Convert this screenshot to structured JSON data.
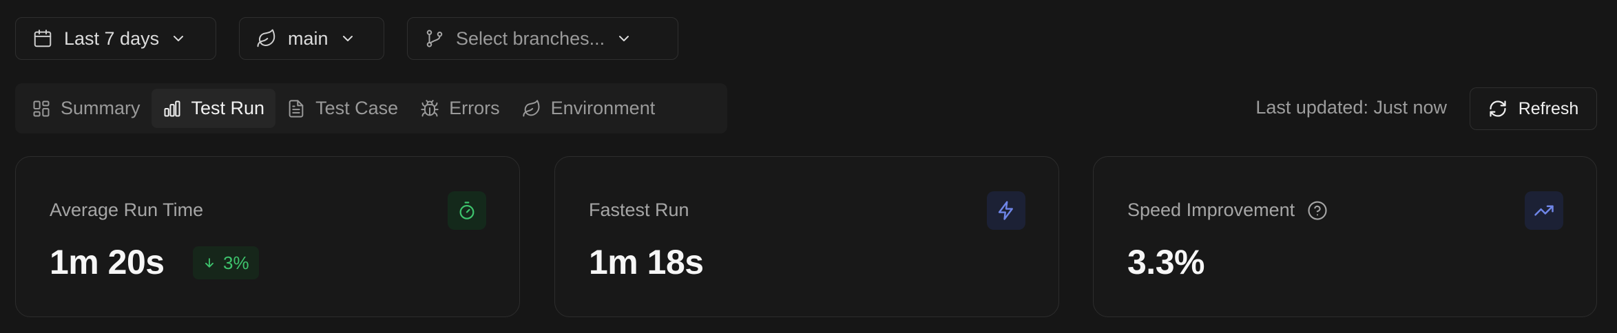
{
  "filters": {
    "date_range": "Last 7 days",
    "branch": "main",
    "branches_placeholder": "Select branches..."
  },
  "tabs": [
    {
      "label": "Summary",
      "icon": "layout-icon",
      "active": false
    },
    {
      "label": "Test Run",
      "icon": "bar-chart-icon",
      "active": true
    },
    {
      "label": "Test Case",
      "icon": "file-icon",
      "active": false
    },
    {
      "label": "Errors",
      "icon": "bug-icon",
      "active": false
    },
    {
      "label": "Environment",
      "icon": "leaf-icon",
      "active": false
    }
  ],
  "status": {
    "last_updated": "Last updated: Just now",
    "refresh_label": "Refresh"
  },
  "cards": [
    {
      "title": "Average Run Time",
      "value": "1m 20s",
      "delta": "3%",
      "delta_direction": "down",
      "icon": "timer-icon",
      "accent": "#3ec46d"
    },
    {
      "title": "Fastest Run",
      "value": "1m 18s",
      "icon": "zap-icon",
      "accent": "#6f86e8"
    },
    {
      "title": "Speed Improvement",
      "value": "3.3%",
      "icon": "trending-up-icon",
      "accent": "#6f86e8"
    }
  ]
}
